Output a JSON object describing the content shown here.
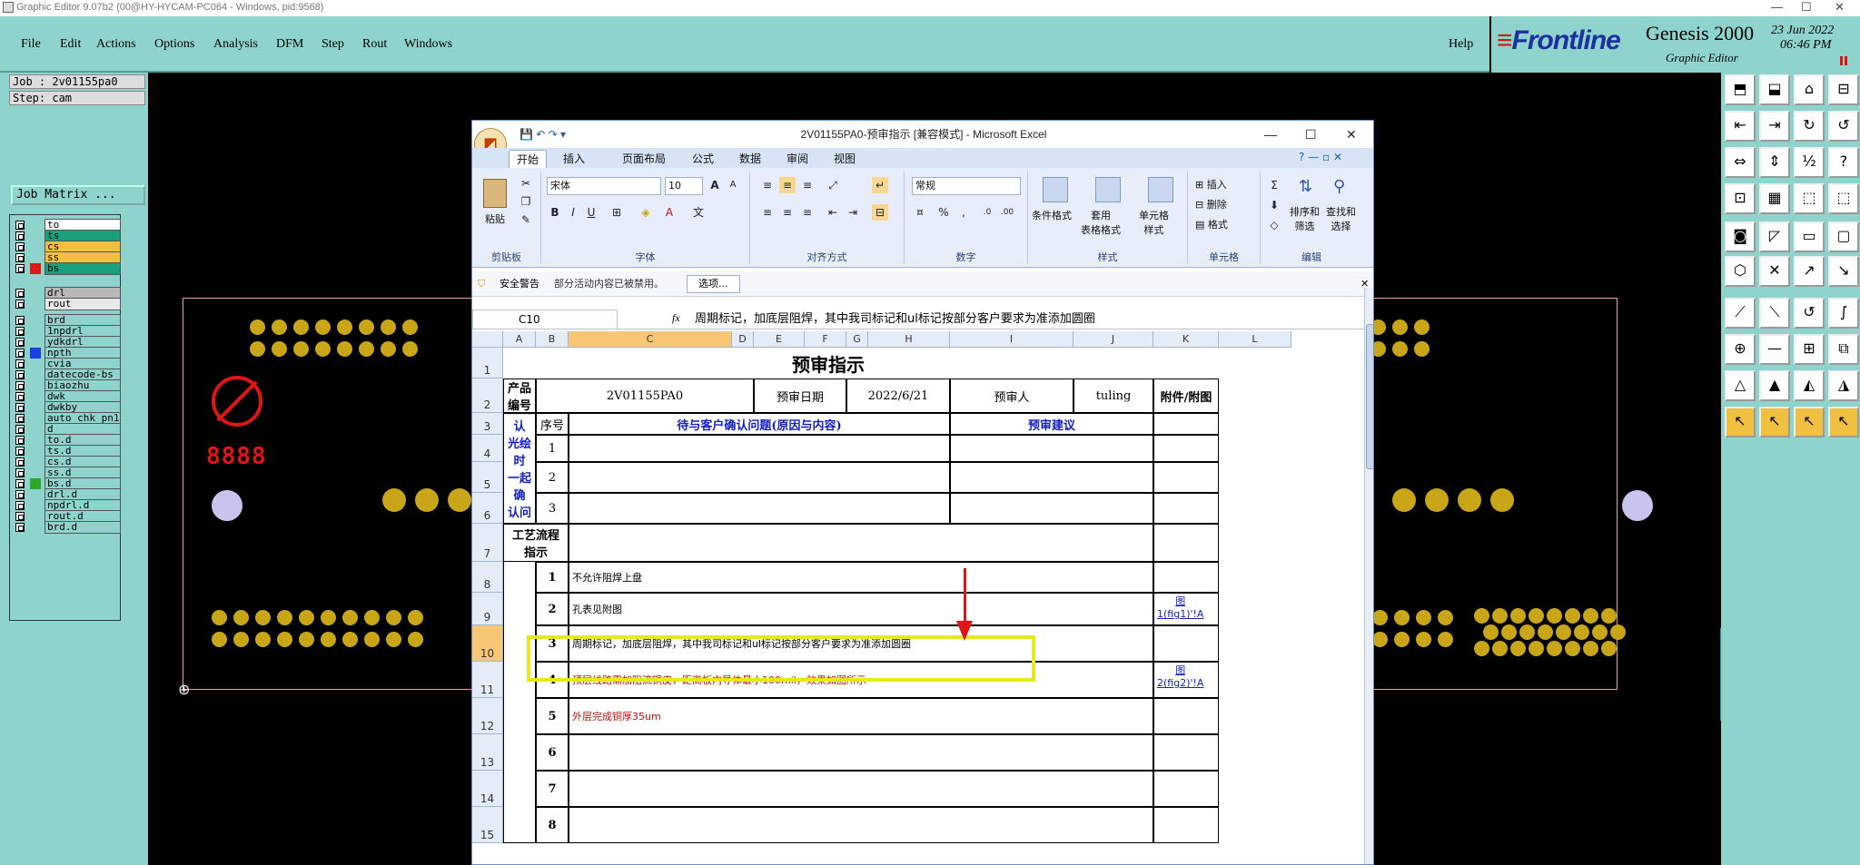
{
  "genesis": {
    "title": "Graphic Editor 9.07b2 (00@HY-HYCAM-PC064 - Windows, pid:9568)",
    "menu": [
      "File",
      "Edit",
      "Actions",
      "Options",
      "Analysis",
      "DFM",
      "Step",
      "Rout",
      "Windows"
    ],
    "help": "Help",
    "brand": "Frontline",
    "product": "Genesis 2000",
    "subtitle": "Graphic Editor",
    "date": "23 Jun 2022",
    "time": "06:46 PM",
    "job": "Job : 2v01155pa0",
    "step": "Step: cam",
    "matrix_btn": "Job Matrix ...",
    "layers": [
      {
        "name": "to",
        "color": "#ffffff",
        "sw": ""
      },
      {
        "name": "ts",
        "color": "#1aa07a",
        "sw": ""
      },
      {
        "name": "cs",
        "color": "#f1c040",
        "sw": ""
      },
      {
        "name": "ss",
        "color": "#f1c040",
        "sw": ""
      },
      {
        "name": "bs",
        "color": "#1aa07a",
        "sw": "#e01515"
      },
      {
        "name": "",
        "color": "#8fd3cd",
        "sw": ""
      },
      {
        "name": "drl",
        "color": "#b8b8b8",
        "sw": ""
      },
      {
        "name": "rout",
        "color": "#e8e8e8",
        "sw": ""
      },
      {
        "name": "",
        "color": "#8fd3cd",
        "sw": ""
      },
      {
        "name": "brd",
        "color": "#8fd3cd",
        "sw": ""
      },
      {
        "name": "1npdrl",
        "color": "#8fd3cd",
        "sw": ""
      },
      {
        "name": "ydkdrl",
        "color": "#8fd3cd",
        "sw": ""
      },
      {
        "name": "npth",
        "color": "#8fd3cd",
        "sw": "#1a3ee0"
      },
      {
        "name": "cvia",
        "color": "#8fd3cd",
        "sw": ""
      },
      {
        "name": "datecode-bs",
        "color": "#8fd3cd",
        "sw": ""
      },
      {
        "name": "biaozhu",
        "color": "#8fd3cd",
        "sw": ""
      },
      {
        "name": "dwk",
        "color": "#8fd3cd",
        "sw": ""
      },
      {
        "name": "dwkby",
        "color": "#8fd3cd",
        "sw": ""
      },
      {
        "name": "auto_chk_pn1",
        "color": "#8fd3cd",
        "sw": ""
      },
      {
        "name": "d",
        "color": "#8fd3cd",
        "sw": ""
      },
      {
        "name": "to.d",
        "color": "#8fd3cd",
        "sw": ""
      },
      {
        "name": "ts.d",
        "color": "#8fd3cd",
        "sw": ""
      },
      {
        "name": "cs.d",
        "color": "#8fd3cd",
        "sw": ""
      },
      {
        "name": "ss.d",
        "color": "#8fd3cd",
        "sw": ""
      },
      {
        "name": "bs.d",
        "color": "#8fd3cd",
        "sw": "#2aa82a"
      },
      {
        "name": "drl.d",
        "color": "#8fd3cd",
        "sw": ""
      },
      {
        "name": "npdrl.d",
        "color": "#8fd3cd",
        "sw": ""
      },
      {
        "name": "rout.d",
        "color": "#8fd3cd",
        "sw": ""
      },
      {
        "name": "brd.d",
        "color": "#8fd3cd",
        "sw": ""
      }
    ],
    "canvas_text": "8888"
  },
  "excel": {
    "title": "2V01155PA0-预审指示 [兼容模式] - Microsoft Excel",
    "tabs": [
      "开始",
      "插入",
      "页面布局",
      "公式",
      "数据",
      "审阅",
      "视图"
    ],
    "ribbon": {
      "paste": "粘贴",
      "clipboard": "剪贴板",
      "font_name": "宋体",
      "font_size": "10",
      "font": "字体",
      "align": "对齐方式",
      "num_format": "常规",
      "number": "数字",
      "cond_format": "条件格式",
      "table_format": "套用\n表格格式",
      "cell_style": "单元格\n样式",
      "styles": "样式",
      "insert": "插入",
      "delete": "删除",
      "format": "格式",
      "cells": "单元格",
      "sort": "排序和\n筛选",
      "find": "查找和\n选择",
      "editing": "编辑"
    },
    "security": {
      "label": "安全警告",
      "msg": "部分活动内容已被禁用。",
      "btn": "选项..."
    },
    "namebox": "C10",
    "formula": "周期标记，加底层阻焊，其中我司标记和ul标记按部分客户要求为准添加圆圈",
    "cols": [
      "A",
      "B",
      "C",
      "D",
      "E",
      "F",
      "G",
      "H",
      "I",
      "J",
      "K",
      "L"
    ],
    "rows": [
      "1",
      "2",
      "3",
      "4",
      "5",
      "6",
      "7",
      "8",
      "9",
      "10",
      "11",
      "12",
      "13",
      "14",
      "15"
    ],
    "sheet": {
      "heading": "预审指示",
      "prod_label": "产品\n编号",
      "prod_no": "2V01155PA0",
      "date_label": "预审日期",
      "date": "2022/6/21",
      "reviewer_label": "预审人",
      "reviewer": "tuling",
      "attach_label": "附件/附图",
      "seq": "序号",
      "issue_col": "待与客户确认问题(原因与内容)",
      "advice_col": "预审建议",
      "pending": "待确认\n光绘时\n一起确\n认问题",
      "flow": "工艺流程\n指示",
      "n1": "1",
      "n2": "2",
      "n3": "3",
      "items": [
        {
          "n": "1",
          "text": "不允许阻焊上盘",
          "red": false
        },
        {
          "n": "2",
          "text": "孔表见附图",
          "red": false
        },
        {
          "n": "3",
          "text": "周期标记，加底层阻焊，其中我司标记和ul标记按部分客户要求为准添加圆圈",
          "red": false
        },
        {
          "n": "4",
          "text": "顶层线路需加阻流铜皮，距离板内导体最小100mil，效果如图所示",
          "red": true
        },
        {
          "n": "5",
          "text": "外层完成铜厚35um",
          "red": true
        },
        {
          "n": "6",
          "text": "",
          "red": false
        },
        {
          "n": "7",
          "text": "",
          "red": false
        },
        {
          "n": "8",
          "text": "",
          "red": false
        }
      ],
      "link1": "图\n1(fig1)'!A",
      "link2": "图\n2(fig2)'!A"
    }
  }
}
